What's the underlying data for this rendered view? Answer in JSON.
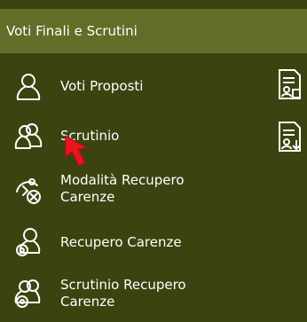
{
  "header": {
    "title": "Voti Finali e Scrutini"
  },
  "menu": {
    "items": [
      {
        "label": "Voti Proposti",
        "icon": "person-icon",
        "side_icon": "document-user-icon"
      },
      {
        "label": "Scrutinio",
        "icon": "group-icon",
        "side_icon": "document-download-icon"
      },
      {
        "label": "Modalità Recupero\nCarenze",
        "icon": "person-cancel-icon"
      },
      {
        "label": "Recupero Carenze",
        "icon": "person-badge-icon"
      },
      {
        "label": "Scrutinio Recupero\nCarenze",
        "icon": "group-badge-icon"
      }
    ]
  },
  "colors": {
    "panel_bg": "#3b4410",
    "header_bg": "#636d27",
    "text": "#ffffff",
    "cursor": "#e8141e"
  }
}
